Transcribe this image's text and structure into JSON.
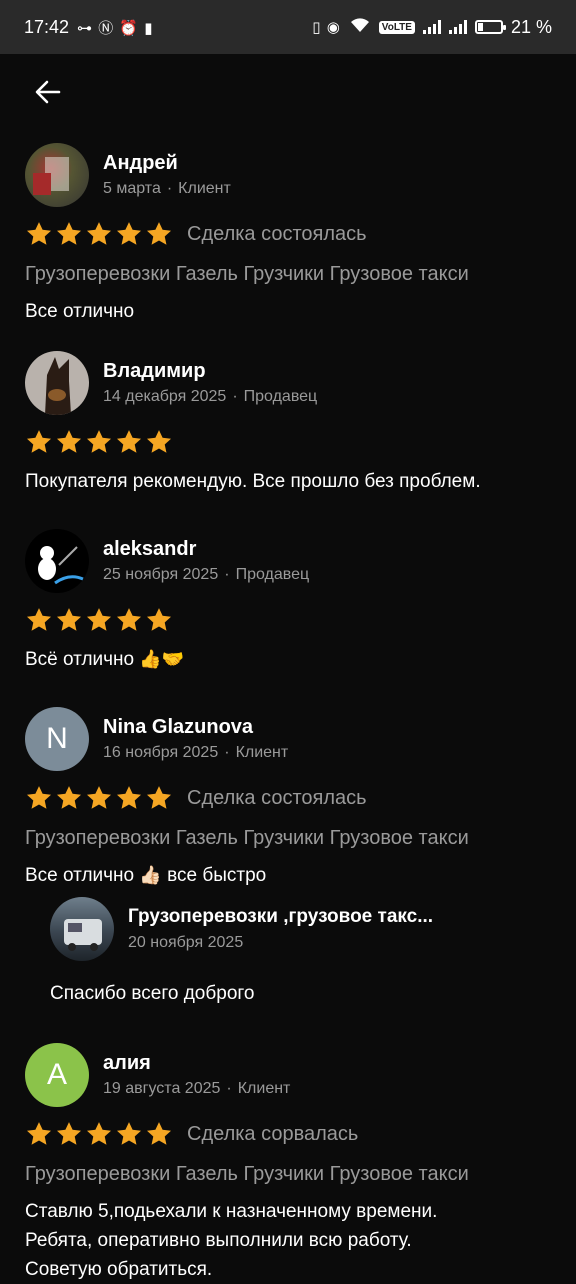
{
  "status_bar": {
    "time": "17:42",
    "left_icons": "⊶ Ⓝ ⏰ ▮",
    "right_icons": "▯ ◉",
    "volte": "VoLTE",
    "battery": "21 %",
    "battery_level_percent": 21
  },
  "reviews": [
    {
      "name": "Андрей",
      "date": "5 марта",
      "role": "Клиент",
      "stars": 5,
      "deal": "Сделка состоялась",
      "tags": "Грузоперевозки Газель Грузчики Грузовое такси",
      "text": "Все отлично",
      "avatar_color": "#6b4a3a"
    },
    {
      "name": "Владимир",
      "date": "14 декабря 2025",
      "role": "Продавец",
      "stars": 5,
      "text": "Покупателя рекомендую. Все прошло без проблем.",
      "avatar_color": "#b9b2ac"
    },
    {
      "name": "aleksandr",
      "date": "25 ноября 2025",
      "role": "Продавец",
      "stars": 5,
      "text": "Всё отлично",
      "emoji": "👍🤝",
      "avatar_color": "#000000"
    },
    {
      "name": "Nina Glazunova",
      "date": "16 ноября 2025",
      "role": "Клиент",
      "stars": 5,
      "deal": "Сделка состоялась",
      "tags": "Грузоперевозки Газель Грузчики Грузовое такси",
      "text_before": "Все отлично",
      "emoji": "👍🏻",
      "text_after": "все быстро",
      "avatar_letter": "N",
      "avatar_color": "#7c8c99"
    },
    {
      "name": "алия",
      "date": "19 августа 2025",
      "role": "Клиент",
      "stars": 5,
      "deal": "Сделка сорвалась",
      "tags": "Грузоперевозки Газель Грузчики Грузовое такси",
      "text_lines": [
        "Ставлю 5,подьехали к назначенному времени.",
        "Ребята, оперативно выполнили всю работу.",
        "Советую обратиться."
      ],
      "avatar_letter": "А",
      "avatar_color": "#8bc34a"
    }
  ],
  "reply": {
    "name": "Грузоперевозки ,грузовое такс...",
    "date": "20 ноября 2025",
    "text": "Спасибо всего доброго"
  },
  "colors": {
    "background": "#0b0b0b",
    "star": "#f5a623",
    "secondary_text": "#9a9a9a"
  }
}
